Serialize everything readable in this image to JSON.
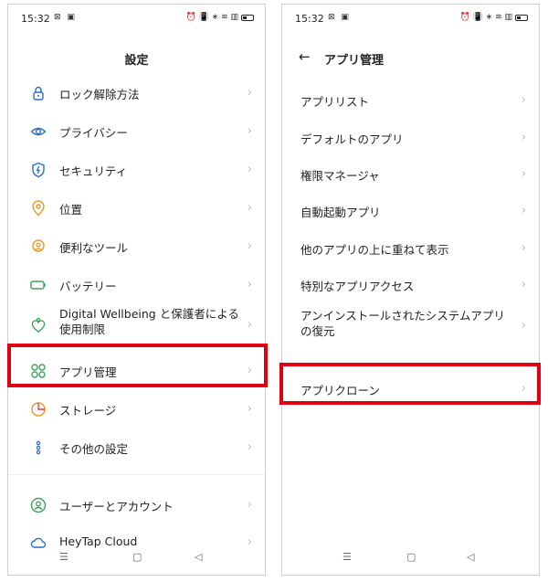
{
  "status": {
    "time": "15:32",
    "left_icons": "⊠ ▣",
    "right_icons": "⏰ 📳 ∗ ≋ ▥"
  },
  "left_screen": {
    "title": "設定",
    "items": [
      {
        "label": "ロック解除方法",
        "icon": "lock-icon"
      },
      {
        "label": "プライバシー",
        "icon": "privacy-eye-icon"
      },
      {
        "label": "セキュリティ",
        "icon": "shield-icon"
      },
      {
        "label": "位置",
        "icon": "location-pin-icon"
      },
      {
        "label": "便利なツール",
        "icon": "tools-icon"
      },
      {
        "label": "バッテリー",
        "icon": "battery-icon"
      },
      {
        "label": "Digital Wellbeing と保護者による使用制限",
        "icon": "heart-person-icon"
      },
      {
        "label": "アプリ管理",
        "icon": "apps-grid-icon"
      },
      {
        "label": "ストレージ",
        "icon": "storage-pie-icon"
      },
      {
        "label": "その他の設定",
        "icon": "more-dots-icon"
      },
      {
        "label": "ユーザーとアカウント",
        "icon": "user-icon"
      },
      {
        "label": "HeyTap Cloud",
        "icon": "cloud-icon"
      }
    ]
  },
  "right_screen": {
    "title": "アプリ管理",
    "items": [
      {
        "label": "アプリリスト"
      },
      {
        "label": "デフォルトのアプリ"
      },
      {
        "label": "権限マネージャ"
      },
      {
        "label": "自動起動アプリ"
      },
      {
        "label": "他のアプリの上に重ねて表示"
      },
      {
        "label": "特別なアプリアクセス"
      },
      {
        "label": "アンインストールされたシステムアプリの復元"
      },
      {
        "label": "アプリクローン"
      }
    ]
  },
  "chevron": "›",
  "back": "←",
  "nav": {
    "menu": "☰",
    "home": "▢",
    "back": "◁"
  },
  "colors": {
    "highlight": "#e00010",
    "icon_blue": "#2f6fc4",
    "icon_orange": "#e59a2a",
    "icon_green": "#3aa45b"
  }
}
